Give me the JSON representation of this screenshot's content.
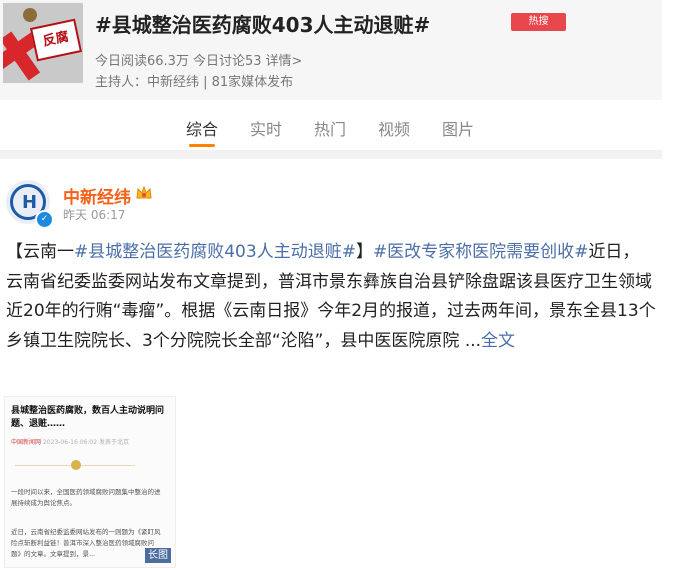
{
  "topic": {
    "thumbnail_text": "反腐",
    "title": "#县城整治医药腐败403人主动退赃#",
    "hot_badge": "热搜",
    "reads": "今日阅读66.3万",
    "discussions": "今日讨论53",
    "details": "详情>",
    "host": "主持人：中新经纬 | 81家媒体发布"
  },
  "tabs": [
    {
      "label": "综合",
      "active": true
    },
    {
      "label": "实时",
      "active": false
    },
    {
      "label": "热门",
      "active": false
    },
    {
      "label": "视频",
      "active": false
    },
    {
      "label": "图片",
      "active": false
    }
  ],
  "post": {
    "author": "中新经纬",
    "time": "昨天 06:17",
    "text_prefix": "【云南一",
    "tag1": "#县城整治医药腐败403人主动退赃#",
    "text_mid": "】",
    "tag2": "#医改专家称医院需要创收#",
    "body": "近日，云南省纪委监委网站发布文章提到，普洱市景东彝族自治县铲除盘踞该县医疗卫生领域近20年的行贿“毒瘤”。根据《云南日报》今年2月的报道，过去两年间，景东全县13个乡镇卫生院院长、3个分院院长全部“沦陷”，县中医医院原院 ...",
    "full_text_link": "全文",
    "image": {
      "title": "县城整治医药腐败，数百人主动说明问题、退赃……",
      "source": "中国新闻网",
      "date": "2023-06-16 06:02",
      "location": "发表于北京",
      "para1": "一段时间以来，全国医药领域腐败问题集中整治的进展持续成为舆论焦点。",
      "para2": "近日，云南省纪委监委网站发布的一则题为《紧盯风险点斩断利益链！普洱市深入整治医药领域腐败问题》的文章。文章提到，景...",
      "badge": "长图"
    }
  },
  "colors": {
    "accent": "#ff8200",
    "link": "#4a6fa8",
    "author": "#f7621a",
    "hot": "#e8474d"
  }
}
